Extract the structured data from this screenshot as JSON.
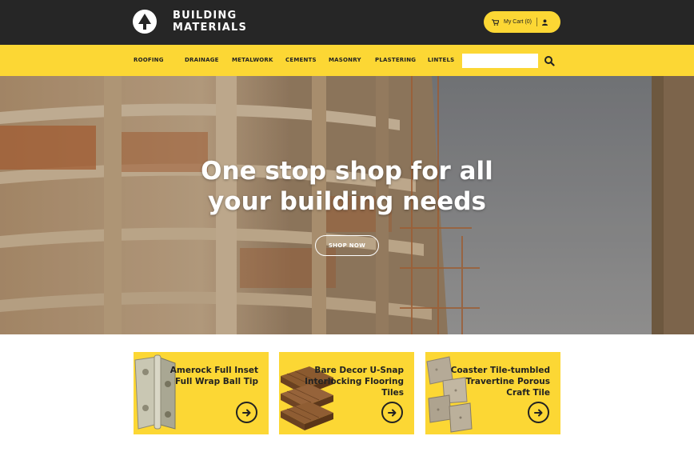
{
  "brand": {
    "line1": "BUILDING",
    "line2": "MATERIALS"
  },
  "cart": {
    "label": "My Cart (0)"
  },
  "nav": {
    "items": [
      "ROOFING",
      "DRAINAGE",
      "METALWORK",
      "CEMENTS",
      "MASONRY",
      "PLASTERING",
      "LINTELS"
    ]
  },
  "search": {
    "placeholder": ""
  },
  "hero": {
    "title_line1": "One stop shop for all",
    "title_line2": "your building needs",
    "cta": "SHOP NOW"
  },
  "products": [
    {
      "line1": "Amerock Full Inset",
      "line2": "Full Wrap Ball Tip",
      "line3": ""
    },
    {
      "line1": "Bare Decor U-Snap",
      "line2": "Interlocking Flooring",
      "line3": "Tiles"
    },
    {
      "line1": "Coaster Tile-tumbled",
      "line2": "Travertine Porous",
      "line3": "Craft Tile"
    }
  ],
  "colors": {
    "accent": "#fcd734",
    "topbar": "#262626",
    "text": "#222222"
  },
  "icons": [
    "tree-logo-icon",
    "cart-icon",
    "user-icon",
    "search-icon",
    "arrow-right-icon"
  ]
}
